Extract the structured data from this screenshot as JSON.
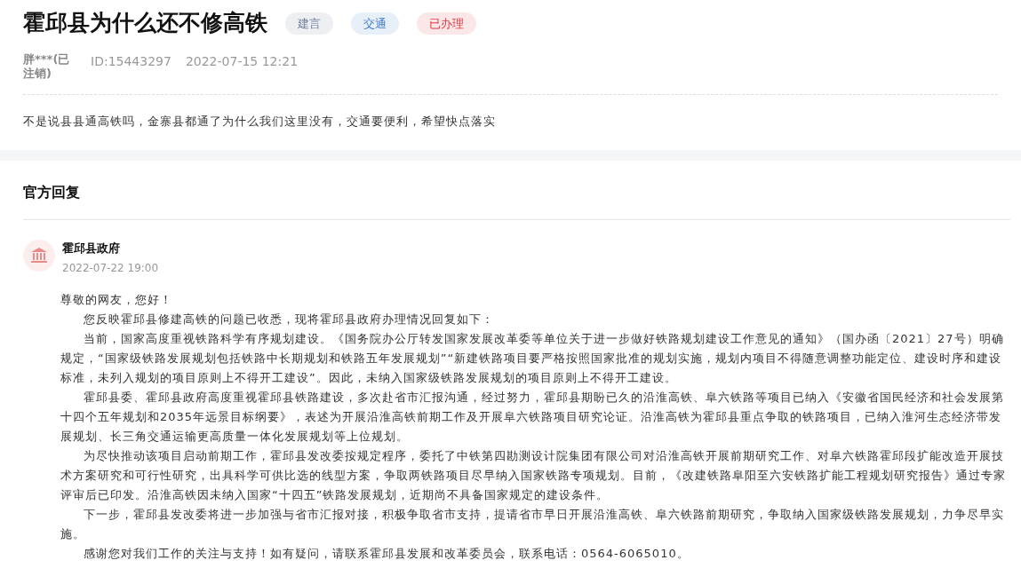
{
  "question": {
    "title": "霍邱县为什么还不修高铁",
    "tags": [
      {
        "label": "建言",
        "color": "#6b7a99"
      },
      {
        "label": "交通",
        "color": "#3a78c9"
      },
      {
        "label": "已办理",
        "color": "#e0383e"
      }
    ],
    "author": "胖***(已注销)",
    "id": "ID:15443297",
    "time": "2022-07-15 12:21",
    "content": "不是说县县通高铁吗，金寨县都通了为什么我们这里没有，交通要便利，希望快点落实"
  },
  "reply": {
    "heading": "官方回复",
    "org": "霍邱县政府",
    "time": "2022-07-22 19:00",
    "greeting": "尊敬的网友，您好！",
    "paragraphs": [
      "您反映霍邱县修建高铁的问题已收悉，现将霍邱县政府办理情况回复如下：",
      "当前，国家高度重视铁路科学有序规划建设。《国务院办公厅转发国家发展改革委等单位关于进一步做好铁路规划建设工作意见的通知》（国办函〔2021〕27号）明确规定，“国家级铁路发展规划包括铁路中长期规划和铁路五年发展规划”“新建铁路项目要严格按照国家批准的规划实施，规划内项目不得随意调整功能定位、建设时序和建设标准，未列入规划的项目原则上不得开工建设”。因此，未纳入国家级铁路发展规划的项目原则上不得开工建设。",
      "霍邱县委、霍邱县政府高度重视霍邱县铁路建设，多次赴省市汇报沟通，经过努力，霍邱县期盼已久的沿淮高铁、阜六铁路等项目已纳入《安徽省国民经济和社会发展第十四个五年规划和2035年远景目标纲要》，表述为开展沿淮高铁前期工作及开展阜六铁路项目研究论证。沿淮高铁为霍邱县重点争取的铁路项目，已纳入淮河生态经济带发展规划、长三角交通运输更高质量一体化发展规划等上位规划。",
      "为尽快推动该项目启动前期工作，霍邱县发改委按规定程序，委托了中铁第四勘测设计院集团有限公司对沿淮高铁开展前期研究工作、对阜六铁路霍邱段扩能改造开展技术方案研究和可行性研究，出具科学可供比选的线型方案，争取两铁路项目尽早纳入国家铁路专项规划。目前，《改建铁路阜阳至六安铁路扩能工程规划研究报告》通过专家评审后已印发。沿淮高铁因未纳入国家“十四五”铁路发展规划，近期尚不具备国家规定的建设条件。",
      "下一步，霍邱县发改委将进一步加强与省市汇报对接，积极争取省市支持，提请省市早日开展沿淮高铁、阜六铁路前期研究，争取纳入国家级铁路发展规划，力争尽早实施。",
      "感谢您对我们工作的关注与支持！如有疑问，请联系霍邱县发展和改革委员会，联系电话：0564-6065010。"
    ]
  }
}
